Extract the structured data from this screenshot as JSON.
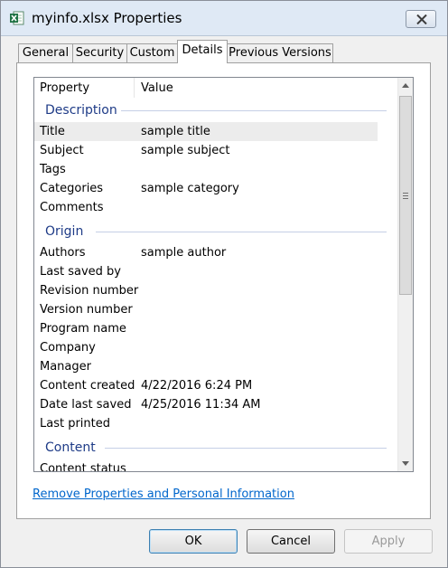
{
  "window": {
    "title": "myinfo.xlsx Properties",
    "icon": "excel-file-icon",
    "close_icon": "close-icon"
  },
  "tabs": [
    {
      "label": "General",
      "active": false
    },
    {
      "label": "Security",
      "active": false
    },
    {
      "label": "Custom",
      "active": false
    },
    {
      "label": "Details",
      "active": true
    },
    {
      "label": "Previous Versions",
      "active": false
    }
  ],
  "details": {
    "columns": {
      "property": "Property",
      "value": "Value"
    },
    "groups": [
      {
        "name": "Description",
        "rows": [
          {
            "property": "Title",
            "value": "sample title",
            "selected": true
          },
          {
            "property": "Subject",
            "value": "sample subject"
          },
          {
            "property": "Tags",
            "value": ""
          },
          {
            "property": "Categories",
            "value": "sample category"
          },
          {
            "property": "Comments",
            "value": ""
          }
        ]
      },
      {
        "name": "Origin",
        "rows": [
          {
            "property": "Authors",
            "value": "sample author"
          },
          {
            "property": "Last saved by",
            "value": ""
          },
          {
            "property": "Revision number",
            "value": ""
          },
          {
            "property": "Version number",
            "value": ""
          },
          {
            "property": "Program name",
            "value": ""
          },
          {
            "property": "Company",
            "value": ""
          },
          {
            "property": "Manager",
            "value": ""
          },
          {
            "property": "Content created",
            "value": "4/22/2016 6:24 PM"
          },
          {
            "property": "Date last saved",
            "value": "4/25/2016 11:34 AM"
          },
          {
            "property": "Last printed",
            "value": ""
          }
        ]
      },
      {
        "name": "Content",
        "rows": [
          {
            "property": "Content status",
            "value": ""
          }
        ]
      }
    ]
  },
  "remove_link": "Remove Properties and Personal Information",
  "buttons": {
    "ok": "OK",
    "cancel": "Cancel",
    "apply": "Apply"
  },
  "colors": {
    "group_header": "#1e3b87",
    "link": "#0066cc",
    "excel_green": "#1f7244"
  }
}
